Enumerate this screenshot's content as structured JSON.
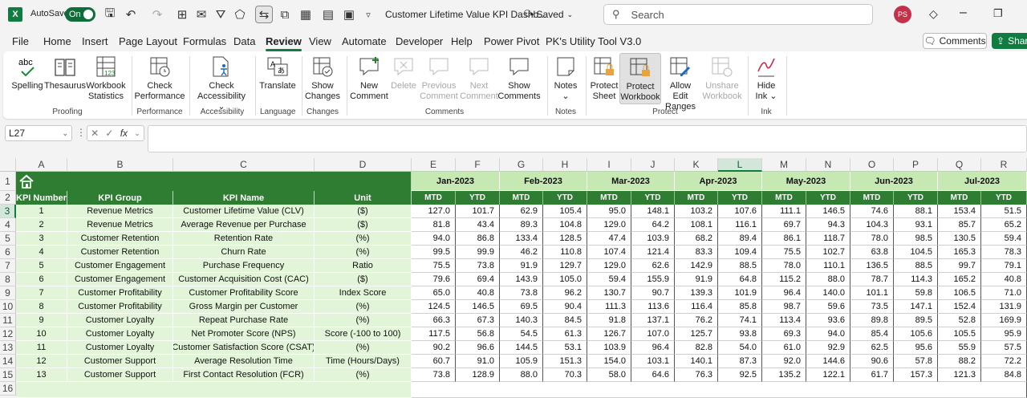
{
  "app": {
    "logo": "X",
    "autosave_label": "AutoSave",
    "autosave_state": "On",
    "title": "Customer Lifetime Value KPI Dashb...",
    "saved": "• Saved",
    "search_placeholder": "Search",
    "avatar": "PS"
  },
  "menu": [
    "File",
    "Home",
    "Insert",
    "Page Layout",
    "Formulas",
    "Data",
    "Review",
    "View",
    "Automate",
    "Developer",
    "Help",
    "Power Pivot",
    "PK's Utility Tool V3.0"
  ],
  "menu_active": "Review",
  "actions": {
    "comments": "Comments",
    "share": "Share"
  },
  "ribbon": {
    "spelling": "Spelling",
    "thesaurus": "Thesaurus",
    "wb_stats_1": "Workbook",
    "wb_stats_2": "Statistics",
    "proofing": "Proofing",
    "check_perf_1": "Check",
    "check_perf_2": "Performance",
    "performance": "Performance",
    "check_acc_1": "Check",
    "check_acc_2": "Accessibility",
    "accessibility": "Accessibility",
    "translate": "Translate",
    "language": "Language",
    "show_changes_1": "Show",
    "show_changes_2": "Changes",
    "changes": "Changes",
    "new_comment_1": "New",
    "new_comment_2": "Comment",
    "delete": "Delete",
    "prev_comment_1": "Previous",
    "prev_comment_2": "Comment",
    "next_comment_1": "Next",
    "next_comment_2": "Comment",
    "show_comments_1": "Show",
    "show_comments_2": "Comments",
    "comments_group": "Comments",
    "notes": "Notes",
    "notes_group": "Notes",
    "protect_sheet_1": "Protect",
    "protect_sheet_2": "Sheet",
    "protect_wb_1": "Protect",
    "protect_wb_2": "Workbook",
    "allow_edit_1": "Allow Edit",
    "allow_edit_2": "Ranges",
    "unshare_1": "Unshare",
    "unshare_2": "Workbook",
    "protect_group": "Protect",
    "hide_ink_1": "Hide",
    "hide_ink_2": "Ink",
    "ink_group": "Ink"
  },
  "formula_bar": {
    "cell_ref": "L27",
    "fx": "fx",
    "value": ""
  },
  "columns": [
    "A",
    "B",
    "C",
    "D",
    "E",
    "F",
    "G",
    "H",
    "I",
    "J",
    "K",
    "L",
    "M",
    "N",
    "O",
    "P",
    "Q",
    "R"
  ],
  "selected_column": "L",
  "rows": [
    "1",
    "2",
    "3",
    "4",
    "5",
    "6",
    "7",
    "8",
    "9",
    "10",
    "11",
    "12",
    "13",
    "14",
    "15",
    "16"
  ],
  "selected_row": "3",
  "headers": {
    "kpi_number": "KPI Number",
    "kpi_group": "KPI Group",
    "kpi_name": "KPI Name",
    "unit": "Unit",
    "mtd": "MTD",
    "ytd": "YTD"
  },
  "months": [
    "Jan-2023",
    "Feb-2023",
    "Mar-2023",
    "Apr-2023",
    "May-2023",
    "Jun-2023",
    "Jul-2023"
  ],
  "kpis": [
    {
      "n": "1",
      "group": "Revenue Metrics",
      "name": "Customer Lifetime Value (CLV)",
      "unit": "($)",
      "vals": [
        "127.0",
        "101.7",
        "62.9",
        "105.4",
        "95.0",
        "148.1",
        "103.2",
        "107.6",
        "111.1",
        "146.5",
        "74.6",
        "88.1",
        "153.4",
        "51.5"
      ]
    },
    {
      "n": "2",
      "group": "Revenue Metrics",
      "name": "Average Revenue per Purchase",
      "unit": "($)",
      "vals": [
        "81.8",
        "43.4",
        "89.3",
        "104.8",
        "129.0",
        "64.2",
        "108.1",
        "116.1",
        "69.7",
        "94.3",
        "104.3",
        "93.1",
        "85.7",
        "65.2"
      ]
    },
    {
      "n": "3",
      "group": "Customer Retention",
      "name": "Retention Rate",
      "unit": "(%)",
      "vals": [
        "94.0",
        "86.8",
        "133.4",
        "128.5",
        "47.4",
        "103.9",
        "68.2",
        "89.4",
        "86.1",
        "118.7",
        "78.0",
        "98.5",
        "130.5",
        "59.4"
      ]
    },
    {
      "n": "4",
      "group": "Customer Retention",
      "name": "Churn Rate",
      "unit": "(%)",
      "vals": [
        "99.5",
        "99.9",
        "46.2",
        "110.8",
        "107.4",
        "121.4",
        "83.3",
        "109.4",
        "75.5",
        "102.7",
        "63.8",
        "104.5",
        "165.3",
        "78.3"
      ]
    },
    {
      "n": "5",
      "group": "Customer Engagement",
      "name": "Purchase Frequency",
      "unit": "Ratio",
      "vals": [
        "75.5",
        "73.8",
        "91.9",
        "129.7",
        "129.0",
        "62.6",
        "142.9",
        "88.5",
        "78.0",
        "110.1",
        "136.5",
        "88.5",
        "99.7",
        "79.1"
      ]
    },
    {
      "n": "6",
      "group": "Customer Engagement",
      "name": "Customer Acquisition Cost (CAC)",
      "unit": "($)",
      "vals": [
        "79.6",
        "69.4",
        "143.9",
        "105.0",
        "59.4",
        "155.9",
        "91.9",
        "64.8",
        "115.2",
        "88.0",
        "78.7",
        "114.3",
        "165.2",
        "40.8"
      ]
    },
    {
      "n": "7",
      "group": "Customer Profitability",
      "name": "Customer Profitability Score",
      "unit": "Index Score",
      "vals": [
        "65.0",
        "40.8",
        "73.8",
        "96.2",
        "130.7",
        "90.7",
        "139.3",
        "101.9",
        "96.4",
        "140.0",
        "101.1",
        "59.8",
        "106.5",
        "71.0"
      ]
    },
    {
      "n": "8",
      "group": "Customer Profitability",
      "name": "Gross Margin per Customer",
      "unit": "(%)",
      "vals": [
        "124.5",
        "146.5",
        "69.5",
        "90.4",
        "111.3",
        "113.6",
        "116.4",
        "85.8",
        "98.7",
        "59.6",
        "73.5",
        "147.1",
        "152.4",
        "131.9"
      ]
    },
    {
      "n": "9",
      "group": "Customer Loyalty",
      "name": "Repeat Purchase Rate",
      "unit": "(%)",
      "vals": [
        "66.3",
        "67.3",
        "140.3",
        "84.5",
        "91.8",
        "137.1",
        "76.2",
        "74.1",
        "113.4",
        "93.6",
        "89.8",
        "89.5",
        "52.8",
        "169.9"
      ]
    },
    {
      "n": "10",
      "group": "Customer Loyalty",
      "name": "Net Promoter Score (NPS)",
      "unit": "Score (-100 to 100)",
      "vals": [
        "117.5",
        "56.8",
        "54.5",
        "61.3",
        "126.7",
        "107.0",
        "125.7",
        "93.8",
        "69.3",
        "94.0",
        "85.4",
        "105.6",
        "105.5",
        "95.9"
      ]
    },
    {
      "n": "11",
      "group": "Customer Loyalty",
      "name": "Customer Satisfaction Score (CSAT)",
      "unit": "(%)",
      "vals": [
        "90.2",
        "96.6",
        "144.5",
        "53.1",
        "103.9",
        "96.4",
        "82.8",
        "54.0",
        "61.0",
        "92.9",
        "62.5",
        "95.6",
        "55.9",
        "57.5"
      ]
    },
    {
      "n": "12",
      "group": "Customer Support",
      "name": "Average Resolution Time",
      "unit": "Time (Hours/Days)",
      "vals": [
        "60.7",
        "91.0",
        "105.9",
        "151.3",
        "154.0",
        "103.1",
        "140.1",
        "87.3",
        "92.0",
        "144.6",
        "90.6",
        "57.8",
        "88.2",
        "72.2"
      ]
    },
    {
      "n": "13",
      "group": "Customer Support",
      "name": "First Contact Resolution (FCR)",
      "unit": "(%)",
      "vals": [
        "73.8",
        "128.9",
        "88.0",
        "70.3",
        "58.0",
        "64.6",
        "76.3",
        "92.5",
        "135.2",
        "122.1",
        "61.7",
        "157.3",
        "121.3",
        "84.8"
      ]
    }
  ]
}
